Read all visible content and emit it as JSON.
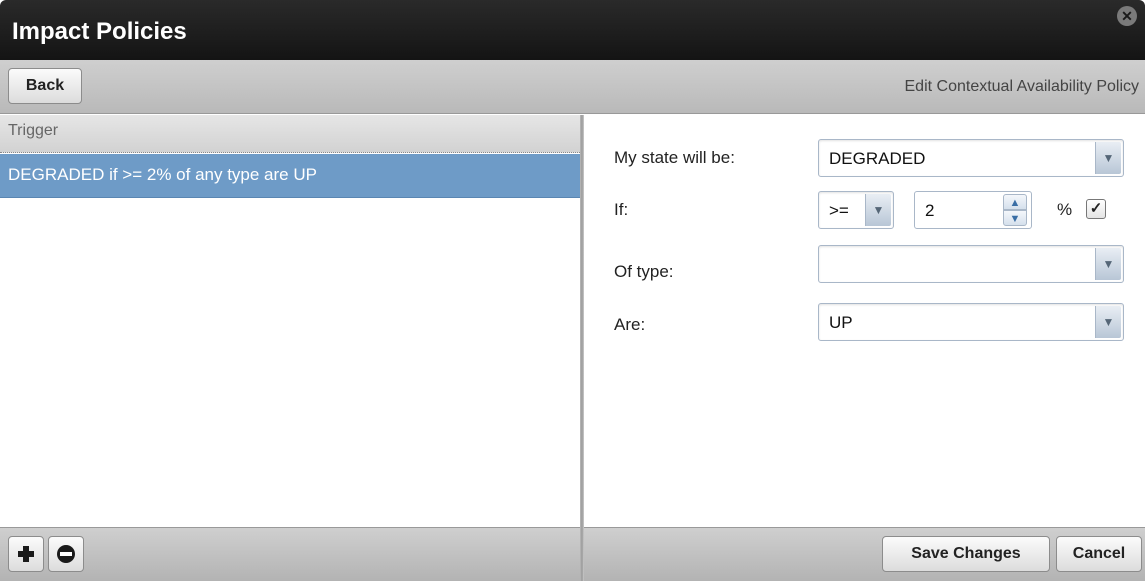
{
  "window": {
    "title": "Impact Policies",
    "close_glyph": "✕"
  },
  "toolbar": {
    "back_label": "Back",
    "caption": "Edit Contextual Availability Policy"
  },
  "trigger_list": {
    "header": "Trigger",
    "items": [
      {
        "label": "DEGRADED if >= 2% of any type are UP",
        "selected": true
      }
    ]
  },
  "form": {
    "state_label": "My state will be:",
    "state_value": "DEGRADED",
    "if_label": "If:",
    "operator_value": ">=",
    "threshold_value": "2",
    "percent_symbol": "%",
    "percent_checked": true,
    "type_label": "Of type:",
    "type_value": "",
    "are_label": "Are:",
    "are_value": "UP"
  },
  "footer": {
    "save_label": "Save Changes",
    "cancel_label": "Cancel"
  },
  "icons": {
    "add": "plus-icon",
    "remove": "minus-circle-icon",
    "dropdown": "chevron-down-icon",
    "check": "checkmark-icon"
  },
  "colors": {
    "selection": "#6e9bc7",
    "titlebar": "#1e1e1e"
  }
}
